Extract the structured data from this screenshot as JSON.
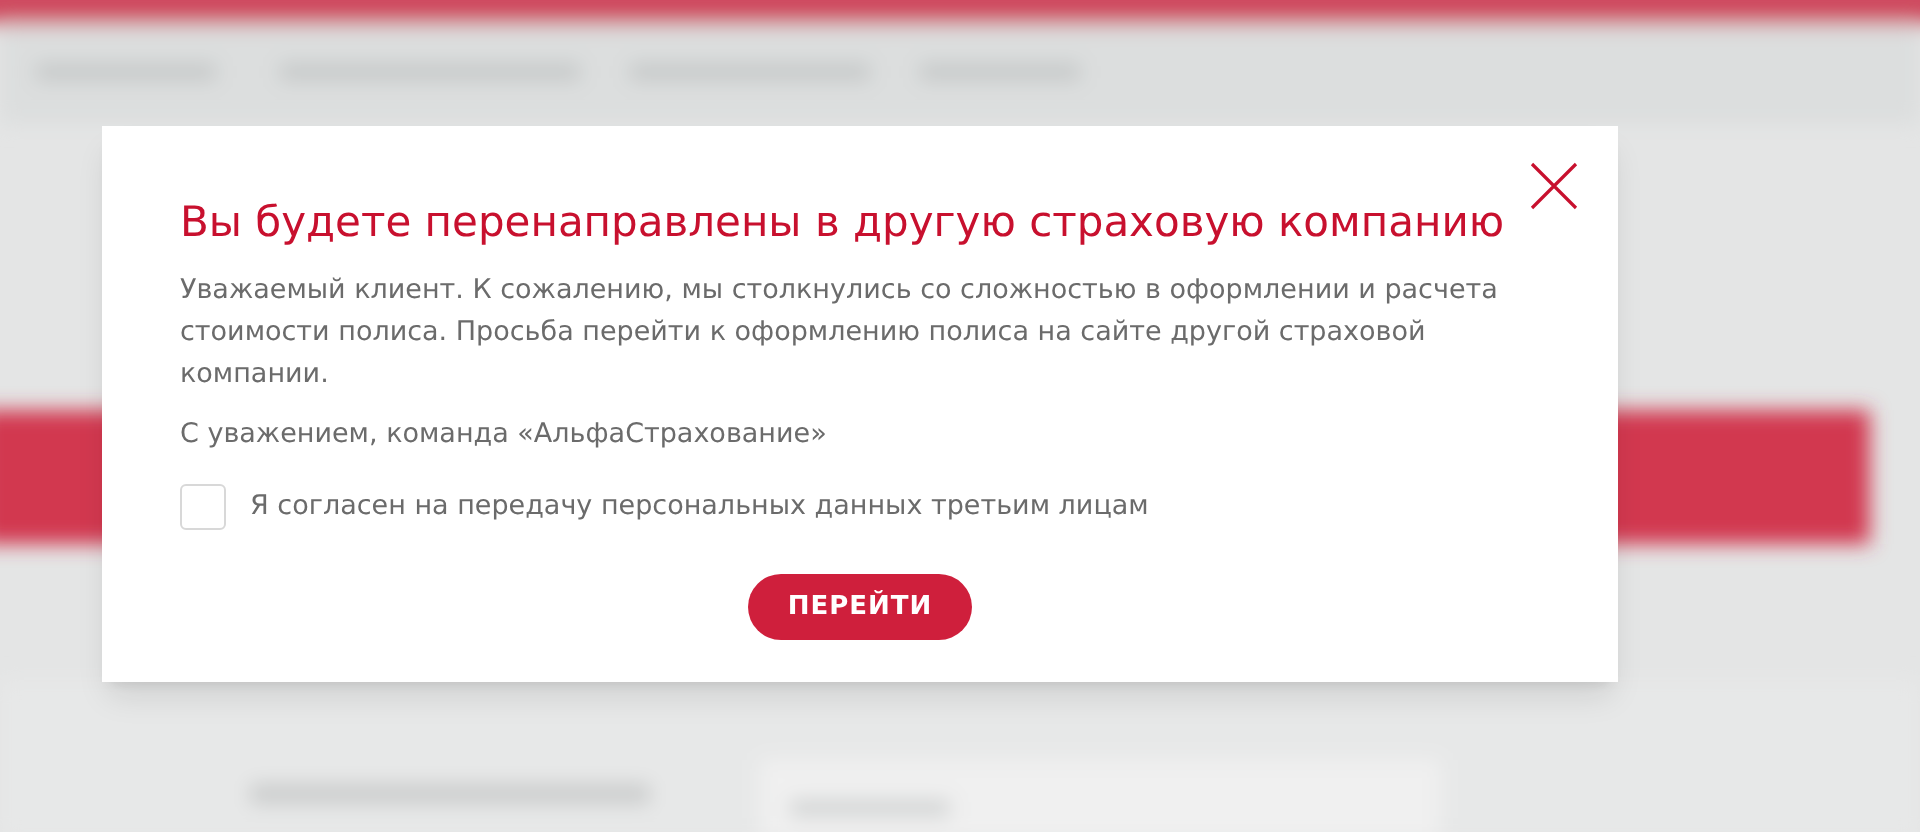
{
  "dialog": {
    "title": "Вы будете перенаправлены в другую страховую компанию",
    "message": "Уважаемый клиент. К сожалению, мы столкнулись со сложностью в оформлении и расчета стоимости полиса. Просьба перейти к оформлению полиса на сайте другой страховой компании.",
    "signature": "С уважением, команда «АльфаСтрахование»",
    "consent": {
      "label": "Я согласен на передачу персональных данных третьим лицам",
      "checked": false
    },
    "button": "ПЕРЕЙТИ"
  }
}
